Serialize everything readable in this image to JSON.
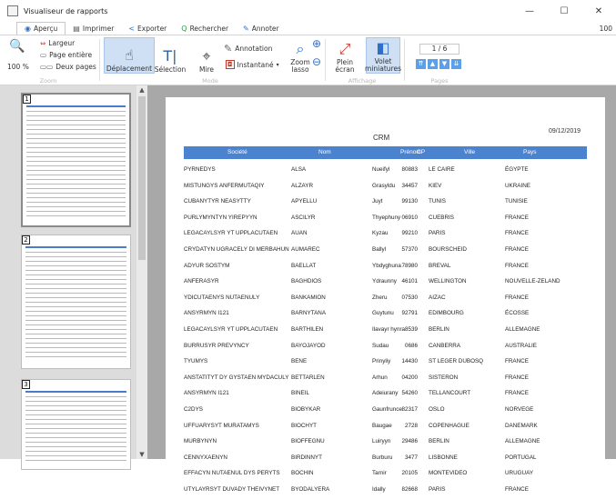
{
  "window": {
    "title": "Visualiseur de rapports",
    "minimize": "—",
    "maximize": "☐",
    "close": "✕"
  },
  "tabs": [
    {
      "label": "Aperçu",
      "icon": "eye-icon"
    },
    {
      "label": "Imprimer",
      "icon": "printer-icon"
    },
    {
      "label": "Exporter",
      "icon": "share-icon"
    },
    {
      "label": "Rechercher",
      "icon": "search-icon"
    },
    {
      "label": "Annoter",
      "icon": "pen-icon"
    }
  ],
  "zoom_level": "100",
  "ribbon": {
    "zoom": {
      "percent": "100 %",
      "largeur": "Largeur",
      "page_entiere": "Page entière",
      "deux_pages": "Deux pages",
      "group_label": "Zoom"
    },
    "mode": {
      "deplacement": "Déplacement",
      "selection": "Sélection",
      "mire": "Mire",
      "annotation": "Annotation",
      "instantane": "Instantané",
      "zoom_lasso": "Zoom\nlasso",
      "group_label": "Mode"
    },
    "affichage": {
      "plein_ecran": "Plein\nécran",
      "volet_miniatures": "Volet\nminiatures",
      "group_label": "Affichage"
    },
    "pages": {
      "current": "1 / 6",
      "group_label": "Pages"
    }
  },
  "thumbnails": [
    {
      "num": "1"
    },
    {
      "num": "2"
    },
    {
      "num": "3"
    }
  ],
  "report": {
    "title": "CRM",
    "date": "09/12/2019",
    "columns": [
      "Société",
      "Nom",
      "Prénom",
      "CP",
      "Ville",
      "Pays"
    ],
    "rows": [
      [
        "PYRNEDYS",
        "ALSA",
        "Nueifyl",
        "80883",
        "LE CAIRE",
        "ÉGYPTE"
      ],
      [
        "MISTUNGYS ANFERMUTAQIY",
        "ALZAYR",
        "Grasyldu",
        "34457",
        "KIEV",
        "UKRAINE"
      ],
      [
        "CUBANYTYR NEASYTTY",
        "APYELLU",
        "Juyt",
        "99130",
        "TUNIS",
        "TUNISIE"
      ],
      [
        "PURLYMYNTYN YIREPYYN",
        "ASCILYR",
        "Thyephuny",
        "06910",
        "CUEBRIS",
        "FRANCE"
      ],
      [
        "LEGACAYLSYR YT UPPLACUTAEN",
        "AUAN",
        "Kyzau",
        "99210",
        "PARIS",
        "FRANCE"
      ],
      [
        "CRYDATYN UGRACELY DI MERBAHUN",
        "AUMAREC",
        "Ballyl",
        "57370",
        "BOURSCHEID",
        "FRANCE"
      ],
      [
        "ADYUR SOSTYM",
        "BAELLAT",
        "Ybdyghuna",
        "78980",
        "BREVAL",
        "FRANCE"
      ],
      [
        "ANFERASYR",
        "BAGHDIOS",
        "Ydraunny",
        "46101",
        "WELLINGTON",
        "NOUVELLE-ZELAND"
      ],
      [
        "YDICUTAENYS NUTAENULY",
        "BANKAMION",
        "Zheru",
        "07530",
        "AIZAC",
        "FRANCE"
      ],
      [
        "ANSYRMYN I121",
        "BARNYTANA",
        "Guytunu",
        "92791",
        "EDIMBOURG",
        "ÉCOSSE"
      ],
      [
        "LEGACAYLSYR YT UPPLACUTAEN",
        "BARTHILEN",
        "Ilavayr hynra",
        "8539",
        "BERLIN",
        "ALLEMAGNE"
      ],
      [
        "BURRUSYR PREVYNCY",
        "BAYOJAYOD",
        "Sudau",
        "0686",
        "CANBERRA",
        "AUSTRALIE"
      ],
      [
        "TYUMYS",
        "BENE",
        "Prinyliy",
        "14430",
        "ST LEGER DUBOSQ",
        "FRANCE"
      ],
      [
        "ANSTATITYT DY GYSTAEN MYDACULY",
        "BETTARLEN",
        "Arhun",
        "04200",
        "SISTERON",
        "FRANCE"
      ],
      [
        "ANSYRMYN I121",
        "BINEIL",
        "Adeiurany",
        "54260",
        "TELLANCOURT",
        "FRANCE"
      ],
      [
        "C2DYS",
        "BIOBYKAR",
        "Gaunfrunce",
        "82317",
        "OSLO",
        "NORVEGE"
      ],
      [
        "UFFUARYSYT MURATAMYS",
        "BIOCHYT",
        "Baugae",
        "2728",
        "COPENHAGUE",
        "DANEMARK"
      ],
      [
        "MURBYNYN",
        "BIOFFEGNU",
        "Luiryyn",
        "29486",
        "BERLIN",
        "ALLEMAGNE"
      ],
      [
        "CENNYXAENYN",
        "BIRDINNYT",
        "Burburu",
        "3477",
        "LISBONNE",
        "PORTUGAL"
      ],
      [
        "EFFACYN NUTAENUL DYS PERYTS",
        "BOCHIN",
        "Tarnir",
        "20105",
        "MONTEVIDEO",
        "URUGUAY"
      ],
      [
        "UTYLAYRSYT DUVADY THEIVYNET",
        "BYODALYERA",
        "Idally",
        "82668",
        "PARIS",
        "FRANCE"
      ]
    ]
  }
}
